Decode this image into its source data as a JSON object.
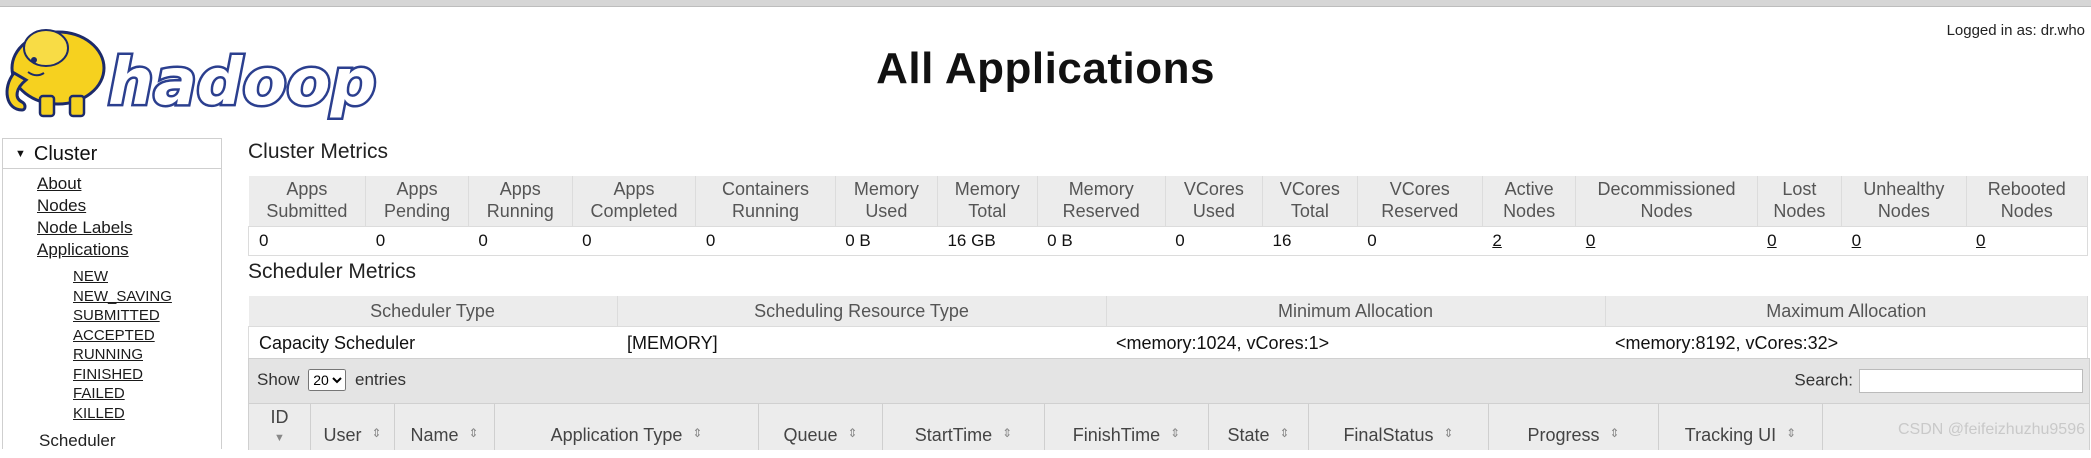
{
  "header": {
    "title": "All Applications",
    "logged_in": "Logged in as: dr.who",
    "logo_text": "hadoop"
  },
  "sidebar": {
    "section_label": "Cluster",
    "links": [
      "About",
      "Nodes",
      "Node Labels",
      "Applications"
    ],
    "app_states": [
      "NEW",
      "NEW_SAVING",
      "SUBMITTED",
      "ACCEPTED",
      "RUNNING",
      "FINISHED",
      "FAILED",
      "KILLED"
    ],
    "next_section": "Scheduler"
  },
  "cluster_metrics": {
    "title": "Cluster Metrics",
    "columns": [
      {
        "label": "Apps Submitted",
        "value": "0"
      },
      {
        "label": "Apps Pending",
        "value": "0"
      },
      {
        "label": "Apps Running",
        "value": "0"
      },
      {
        "label": "Apps Completed",
        "value": "0"
      },
      {
        "label": "Containers Running",
        "value": "0"
      },
      {
        "label": "Memory Used",
        "value": "0 B"
      },
      {
        "label": "Memory Total",
        "value": "16 GB"
      },
      {
        "label": "Memory Reserved",
        "value": "0 B"
      },
      {
        "label": "VCores Used",
        "value": "0"
      },
      {
        "label": "VCores Total",
        "value": "16"
      },
      {
        "label": "VCores Reserved",
        "value": "0"
      },
      {
        "label": "Active Nodes",
        "value": "2"
      },
      {
        "label": "Decommissioned Nodes",
        "value": "0"
      },
      {
        "label": "Lost Nodes",
        "value": "0"
      },
      {
        "label": "Unhealthy Nodes",
        "value": "0"
      },
      {
        "label": "Rebooted Nodes",
        "value": "0"
      }
    ]
  },
  "scheduler_metrics": {
    "title": "Scheduler Metrics",
    "columns": [
      "Scheduler Type",
      "Scheduling Resource Type",
      "Minimum Allocation",
      "Maximum Allocation"
    ],
    "values": [
      "Capacity Scheduler",
      "[MEMORY]",
      "<memory:1024, vCores:1>",
      "<memory:8192, vCores:32>"
    ]
  },
  "applications": {
    "show_label": "Show",
    "entries_value": "20",
    "entries_label": "entries",
    "search_label": "Search:",
    "search_value": "",
    "columns": [
      "ID",
      "User",
      "Name",
      "Application Type",
      "Queue",
      "StartTime",
      "FinishTime",
      "State",
      "FinalStatus",
      "Progress",
      "Tracking UI"
    ]
  },
  "watermark": "CSDN @feifeizhuzhu9596",
  "colors": {
    "header_bg": "#ececec",
    "border": "#dcdcdc",
    "logo_yellow": "#f6d11f",
    "logo_blue": "#2b3f8f"
  }
}
